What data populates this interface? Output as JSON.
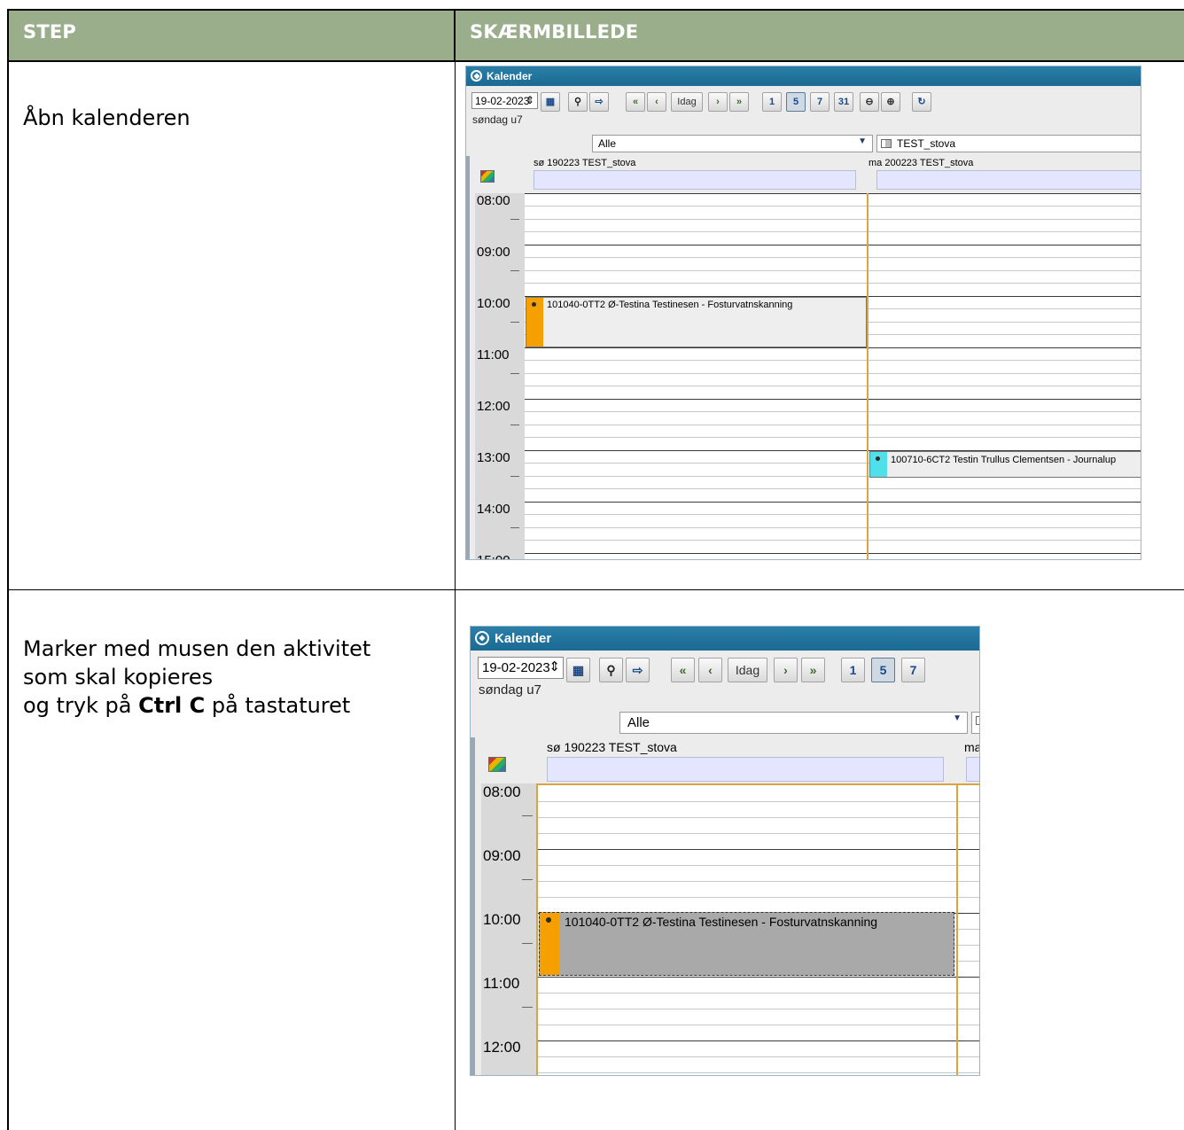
{
  "header": {
    "step": "STEP",
    "screenshot": "SKÆRMBILLEDE"
  },
  "steps": [
    {
      "text": "Åbn kalenderen"
    },
    {
      "line1": "Marker med musen den aktivitet",
      "line2": "som skal kopieres",
      "line3_pre": "og tryk på ",
      "line3_bold": "Ctrl C",
      "line3_post": " på tastaturet"
    }
  ],
  "calendar": {
    "title": "Kalender",
    "date": "19-02-2023",
    "weekday": "søndag u7",
    "spinner": "⇕",
    "today_button": "Idag",
    "view_buttons": [
      "1",
      "5",
      "7",
      "31"
    ],
    "filter": "Alle",
    "resource": "TEST_stova",
    "day1_title": "sø 190223 TEST_stova",
    "day2_title": "ma 200223 TEST_stova",
    "day2_title_short": "ma",
    "hours": [
      "08:00",
      "09:00",
      "10:00",
      "11:00",
      "12:00",
      "13:00",
      "14:00",
      "15:00"
    ],
    "event1": "101040-0TT2  Ø-Testina Testinesen - Fosturvatnskanning",
    "event2": "100710-6CT2  Testin Trullus Clementsen - Journalup",
    "colors": {
      "event1": "#f5a000",
      "event2": "#4fe0ea",
      "titlebar": "#1a6a92"
    }
  }
}
